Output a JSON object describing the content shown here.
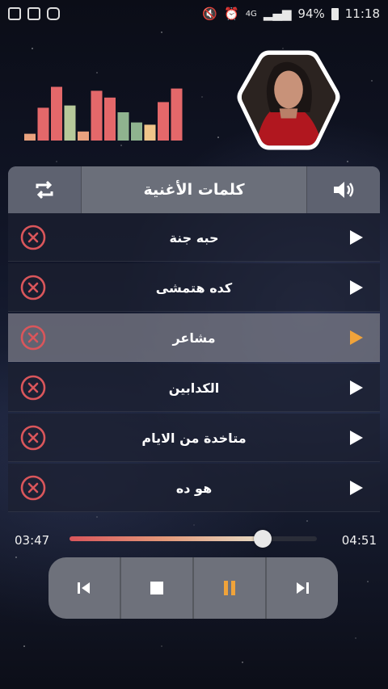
{
  "status_bar": {
    "time": "11:18",
    "battery": "94%",
    "network": "4G",
    "left_icons": [
      "gallery-icon",
      "image-icon",
      "instagram-icon"
    ],
    "right_icons": [
      "mute-icon",
      "alarm-icon",
      "signal-icon",
      "battery-icon"
    ]
  },
  "equalizer": {
    "levels": [
      0.12,
      0.58,
      0.95,
      0.62,
      0.16,
      0.88,
      0.76,
      0.5,
      0.32,
      0.28,
      0.68,
      0.92
    ],
    "colors": [
      "#e9a27e",
      "#e4686a",
      "#e4686a",
      "#b7c99a",
      "#e9a27e",
      "#e4686a",
      "#e4686a",
      "#8fb38f",
      "#8fb38f",
      "#f0c58a",
      "#e4686a",
      "#e4686a"
    ]
  },
  "header": {
    "title": "كلمات الأغنية",
    "left_icon": "repeat-icon",
    "right_icon": "volume-icon"
  },
  "songs": [
    {
      "title": "حبه جنة",
      "active": false
    },
    {
      "title": "كده هتمشى",
      "active": false
    },
    {
      "title": "مشاعر",
      "active": true
    },
    {
      "title": "الكدابين",
      "active": false
    },
    {
      "title": "متاخدة من الايام",
      "active": false
    },
    {
      "title": "هو ده",
      "active": false
    }
  ],
  "player": {
    "current_time": "03:47",
    "total_time": "04:51",
    "progress": 0.78
  },
  "colors": {
    "accent": "#f0a33a",
    "remove": "#d9565b",
    "panel": "#6e717b"
  }
}
